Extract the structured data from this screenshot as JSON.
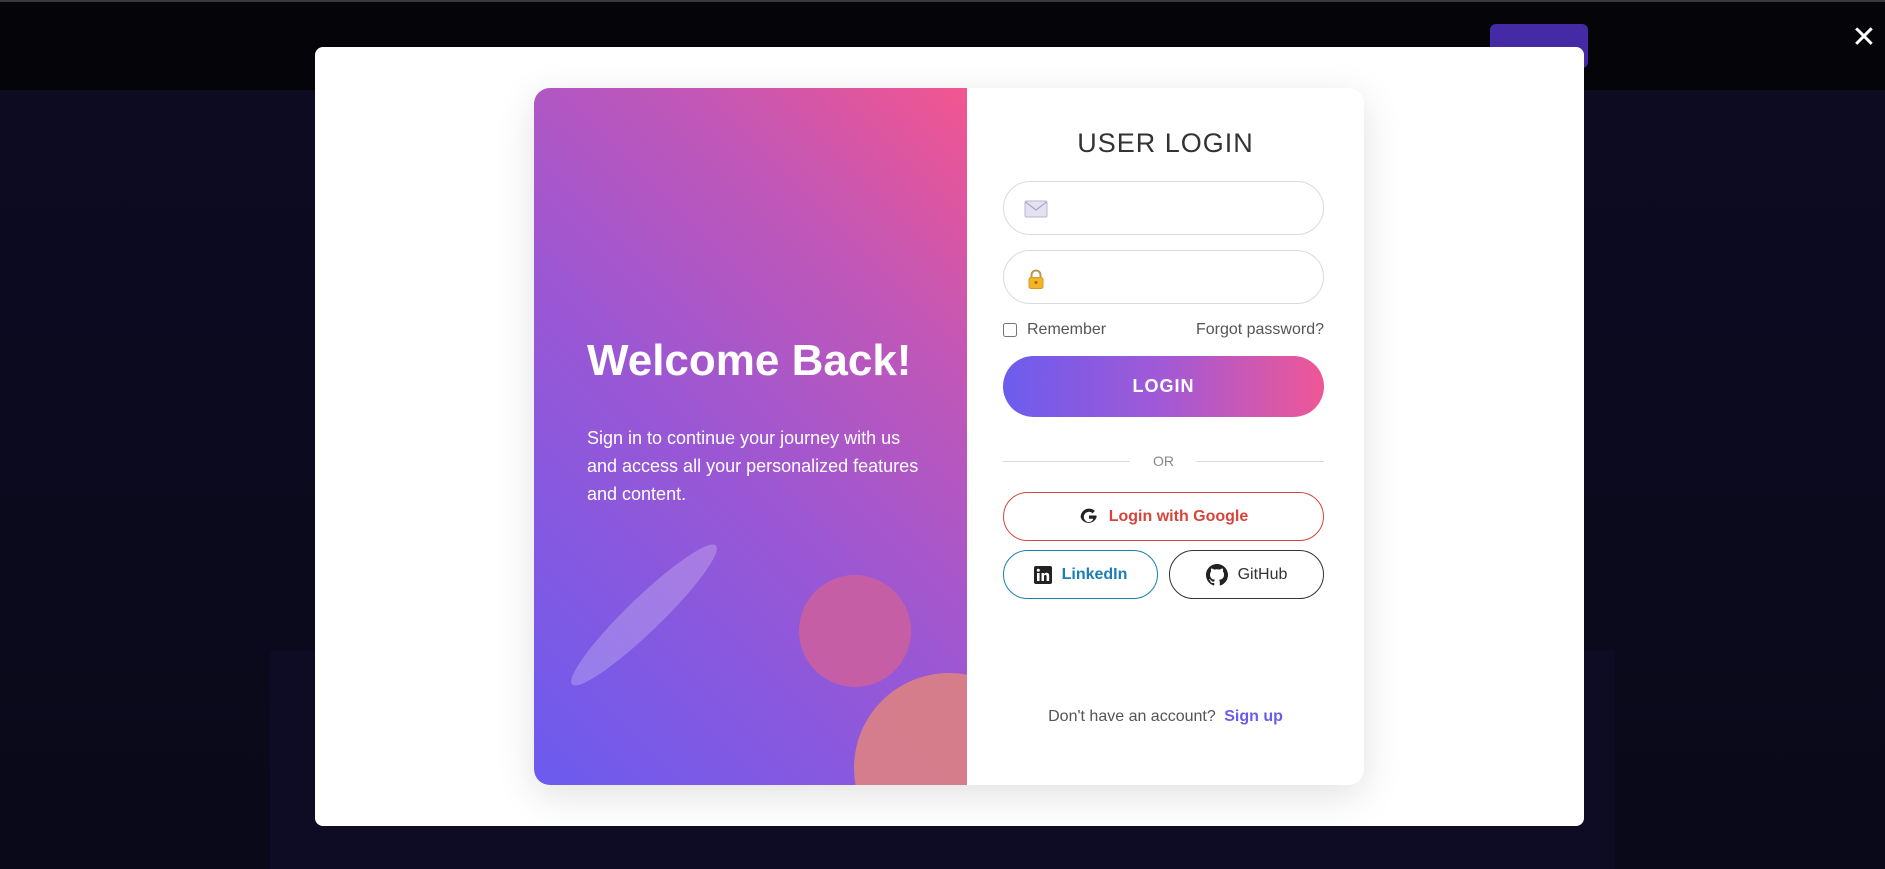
{
  "modal": {
    "close_label": "✕"
  },
  "welcome": {
    "title": "Welcome Back!",
    "text": "Sign in to continue your journey with us and access all your personalized features and content."
  },
  "login": {
    "title": "USER LOGIN",
    "email": {
      "icon": "envelope-icon",
      "value": "",
      "placeholder": ""
    },
    "password": {
      "icon": "lock-icon",
      "value": "",
      "placeholder": ""
    },
    "remember_label": "Remember",
    "remember_checked": false,
    "forgot_label": "Forgot password?",
    "submit_label": "LOGIN",
    "divider_label": "OR"
  },
  "social": {
    "google_label": "Login with Google",
    "google_icon": "google-icon",
    "linkedin_label": "LinkedIn",
    "linkedin_icon": "linkedin-icon",
    "github_label": "GitHub",
    "github_icon": "github-icon"
  },
  "signup": {
    "prompt": "Don't have an account?",
    "link_label": "Sign up"
  },
  "colors": {
    "accent_purple": "#6a5bef",
    "accent_pink": "#f2568f",
    "google_red": "#d6453b",
    "linkedin_blue": "#1a7fb5"
  }
}
